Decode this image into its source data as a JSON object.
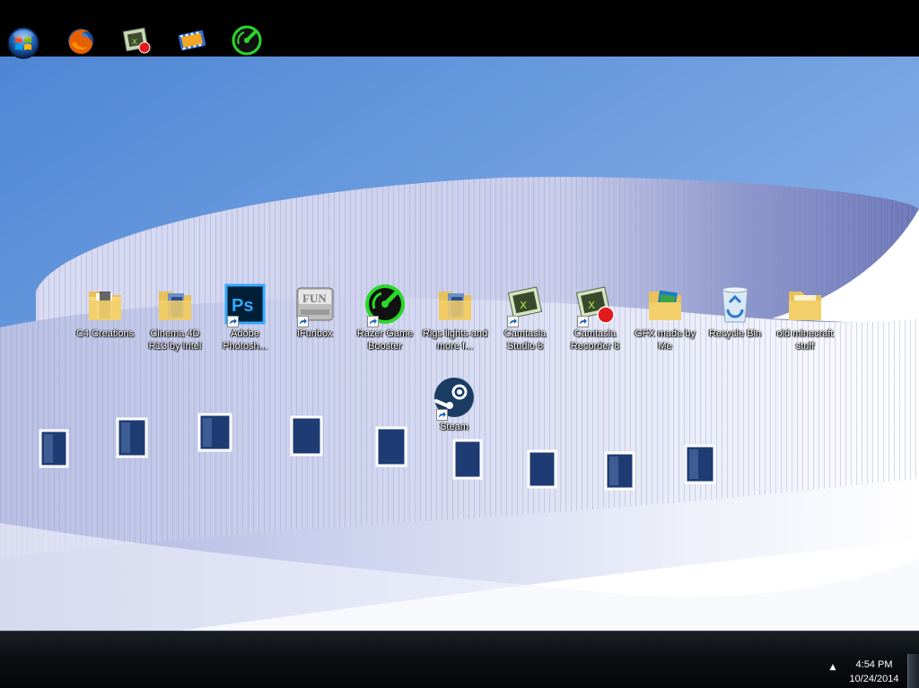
{
  "desktop": {
    "icons": [
      {
        "label": "C4 Creations",
        "icon": "folder-icon"
      },
      {
        "label": "Cinema 4D R13 by Intel",
        "icon": "folder-icon"
      },
      {
        "label": "Adobe Photosh...",
        "icon": "photoshop-icon",
        "shortcut": true
      },
      {
        "label": "iFunbox",
        "icon": "ifunbox-icon",
        "shortcut": true
      },
      {
        "label": "Razer Game Booster",
        "icon": "razer-icon",
        "shortcut": true
      },
      {
        "label": "Rigs lights and more f...",
        "icon": "folder-icon"
      },
      {
        "label": "Camtasia Studio 8",
        "icon": "camtasia-icon",
        "shortcut": true
      },
      {
        "label": "Camtasia Recorder 8",
        "icon": "camtasia-recorder-icon",
        "shortcut": true
      },
      {
        "label": "GFX made by Me",
        "icon": "folder-icon"
      },
      {
        "label": "Recycle Bin",
        "icon": "recycle-bin-icon"
      },
      {
        "label": "old minecraft stuff",
        "icon": "folder-icon"
      },
      {
        "label": "Steam",
        "icon": "steam-icon",
        "shortcut": true
      }
    ]
  },
  "taskbar": {
    "pinned": [
      {
        "name": "start-button",
        "icon": "windows-orb-icon"
      },
      {
        "name": "firefox",
        "icon": "firefox-icon"
      },
      {
        "name": "camtasia-recorder",
        "icon": "camtasia-recorder-icon"
      },
      {
        "name": "camtasia-studio",
        "icon": "film-icon"
      },
      {
        "name": "razer-game-booster",
        "icon": "razer-icon"
      }
    ],
    "tray": {
      "arrow": "▲",
      "time": "4:54 PM",
      "date": "10/24/2014"
    }
  },
  "colors": {
    "sky": "#5b8fd9",
    "building": "#dfe3f4",
    "taskbar": "#0c0f12"
  }
}
